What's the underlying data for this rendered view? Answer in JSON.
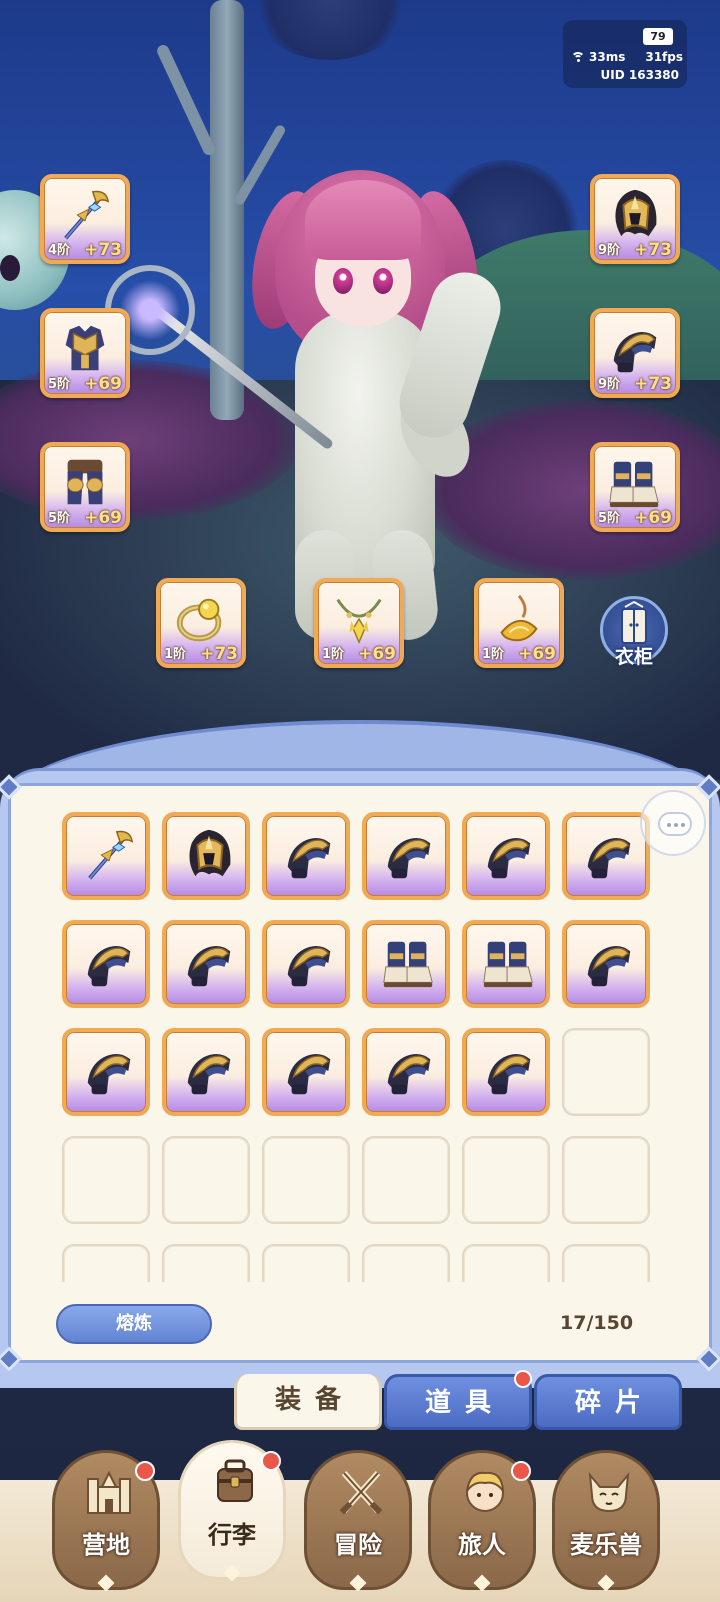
{
  "hud": {
    "battery": "79",
    "ping": "33ms",
    "fps": "31fps",
    "uid": "UID 163380"
  },
  "equipped": [
    {
      "slot": "weapon",
      "icon": "staff-weapon-icon",
      "tier": "4阶",
      "bonus": "+73"
    },
    {
      "slot": "chest",
      "icon": "chest-armor-icon",
      "tier": "5阶",
      "bonus": "+69"
    },
    {
      "slot": "legs",
      "icon": "leg-armor-icon",
      "tier": "5阶",
      "bonus": "+69"
    },
    {
      "slot": "helmet",
      "icon": "helmet-icon",
      "tier": "9阶",
      "bonus": "+73"
    },
    {
      "slot": "gloves",
      "icon": "gauntlet-icon",
      "tier": "9阶",
      "bonus": "+73"
    },
    {
      "slot": "boots",
      "icon": "boots-icon",
      "tier": "5阶",
      "bonus": "+69"
    },
    {
      "slot": "ring",
      "icon": "ring-icon",
      "tier": "1阶",
      "bonus": "+73"
    },
    {
      "slot": "necklace",
      "icon": "necklace-icon",
      "tier": "1阶",
      "bonus": "+69"
    },
    {
      "slot": "charm",
      "icon": "charm-icon",
      "tier": "1阶",
      "bonus": "+69"
    }
  ],
  "wardrobe_label": "衣柜",
  "inventory": {
    "items": [
      "staff-weapon-icon",
      "helmet-icon",
      "gauntlet-icon",
      "gauntlet-icon",
      "gauntlet-icon",
      "gauntlet-icon",
      "gauntlet-icon",
      "gauntlet-icon",
      "gauntlet-icon",
      "boots-icon",
      "boots-icon",
      "gauntlet-icon",
      "gauntlet-icon",
      "gauntlet-icon",
      "gauntlet-icon",
      "gauntlet-icon",
      "gauntlet-icon"
    ],
    "smelt_label": "熔炼",
    "capacity": "17/150"
  },
  "tabs": [
    {
      "label": "装备",
      "active": true,
      "badge": false
    },
    {
      "label": "道具",
      "active": false,
      "badge": true
    },
    {
      "label": "碎片",
      "active": false,
      "badge": false
    }
  ],
  "nav": [
    {
      "label": "营地",
      "icon": "castle-icon",
      "active": false,
      "badge": true
    },
    {
      "label": "行李",
      "icon": "bag-icon",
      "active": true,
      "badge": true
    },
    {
      "label": "冒险",
      "icon": "crossed-swords-icon",
      "active": false,
      "badge": false
    },
    {
      "label": "旅人",
      "icon": "traveler-icon",
      "active": false,
      "badge": true
    },
    {
      "label": "麦乐兽",
      "icon": "beast-icon",
      "active": false,
      "badge": false
    }
  ],
  "colors": {
    "slot_border": "#f0a955",
    "rarity_purple": "#b58ae4",
    "panel_blue": "#8da7de",
    "badge_red": "#e8574a"
  }
}
